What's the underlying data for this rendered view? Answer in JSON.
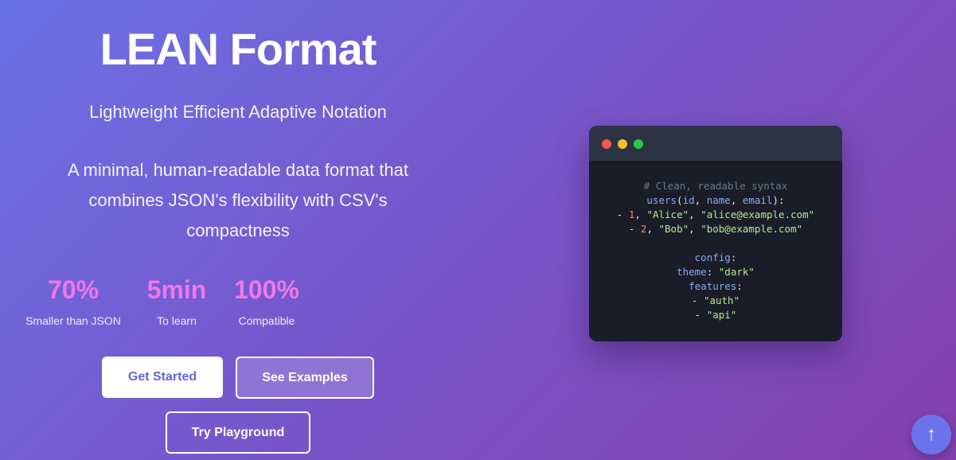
{
  "hero": {
    "title": "LEAN Format",
    "subtitle": "Lightweight Efficient Adaptive Notation",
    "description": "A minimal, human-readable data format that combines JSON's flexibility with CSV's compactness"
  },
  "stats": [
    {
      "value": "70%",
      "label": "Smaller than JSON"
    },
    {
      "value": "5min",
      "label": "To learn"
    },
    {
      "value": "100%",
      "label": "Compatible"
    }
  ],
  "buttons": {
    "get_started": "Get Started",
    "see_examples": "See Examples",
    "try_playground": "Try Playground"
  },
  "code_window": {
    "window_controls": [
      "close",
      "minimize",
      "maximize"
    ],
    "lines": [
      [
        {
          "t": "# Clean, readable syntax",
          "k": "comment"
        }
      ],
      [
        {
          "t": "users",
          "k": "key"
        },
        {
          "t": "(",
          "k": "punct"
        },
        {
          "t": "id",
          "k": "key"
        },
        {
          "t": ", ",
          "k": "punct"
        },
        {
          "t": "name",
          "k": "key"
        },
        {
          "t": ", ",
          "k": "punct"
        },
        {
          "t": "email",
          "k": "key"
        },
        {
          "t": "):",
          "k": "punct"
        }
      ],
      [
        {
          "t": "- ",
          "k": "punct"
        },
        {
          "t": "1",
          "k": "num"
        },
        {
          "t": ", ",
          "k": "punct"
        },
        {
          "t": "\"Alice\"",
          "k": "str"
        },
        {
          "t": ", ",
          "k": "punct"
        },
        {
          "t": "\"alice@example.com\"",
          "k": "str"
        }
      ],
      [
        {
          "t": "- ",
          "k": "punct"
        },
        {
          "t": "2",
          "k": "num"
        },
        {
          "t": ", ",
          "k": "punct"
        },
        {
          "t": "\"Bob\"",
          "k": "str"
        },
        {
          "t": ", ",
          "k": "punct"
        },
        {
          "t": "\"bob@example.com\"",
          "k": "str"
        }
      ],
      [],
      [
        {
          "t": "config",
          "k": "key"
        },
        {
          "t": ":",
          "k": "punct"
        }
      ],
      [
        {
          "t": "theme",
          "k": "key"
        },
        {
          "t": ": ",
          "k": "punct"
        },
        {
          "t": "\"dark\"",
          "k": "str"
        }
      ],
      [
        {
          "t": "features",
          "k": "key"
        },
        {
          "t": ":",
          "k": "punct"
        }
      ],
      [
        {
          "t": "- ",
          "k": "punct"
        },
        {
          "t": "\"auth\"",
          "k": "str"
        }
      ],
      [
        {
          "t": "- ",
          "k": "punct"
        },
        {
          "t": "\"api\"",
          "k": "str"
        }
      ]
    ]
  },
  "scroll_top": {
    "icon": "arrow-up-icon",
    "glyph": "↑"
  },
  "colors": {
    "accent": "#f177e8",
    "primary_button_text": "#6266de",
    "code_background": "#1a1d28",
    "code_titlebar": "#2c3343"
  }
}
